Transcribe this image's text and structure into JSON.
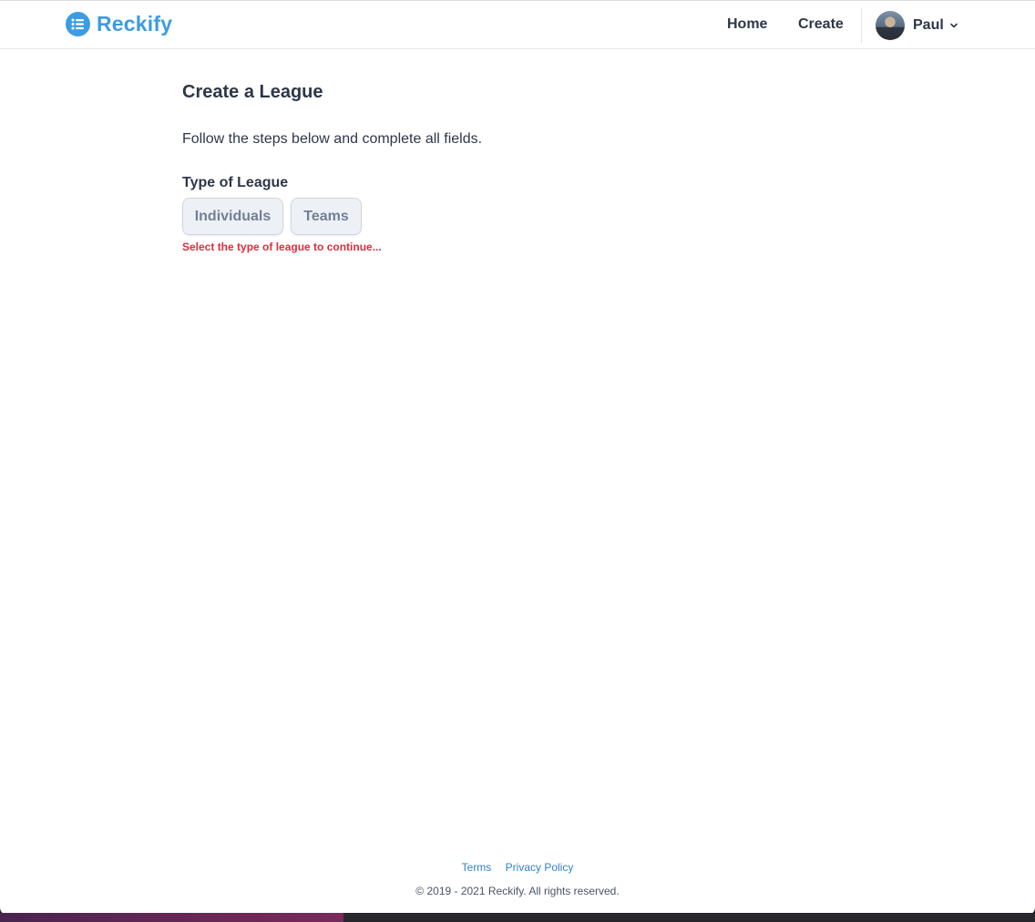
{
  "header": {
    "brand": "Reckify",
    "nav": {
      "home": "Home",
      "create": "Create"
    },
    "user": {
      "name": "Paul"
    },
    "colors": {
      "brand": "#3b9ce3"
    }
  },
  "main": {
    "title": "Create a League",
    "intro": "Follow the steps below and complete all fields.",
    "league_type": {
      "label": "Type of League",
      "options": [
        "Individuals",
        "Teams"
      ],
      "error": "Select the type of league to continue...",
      "error_color": "#e02c3c"
    }
  },
  "footer": {
    "links": {
      "terms": "Terms",
      "privacy": "Privacy Policy"
    },
    "copyright": "© 2019 - 2021 Reckify. All rights reserved."
  },
  "icons": {
    "brand_icon": "list-icon",
    "user_menu": "chevron-down-icon"
  }
}
